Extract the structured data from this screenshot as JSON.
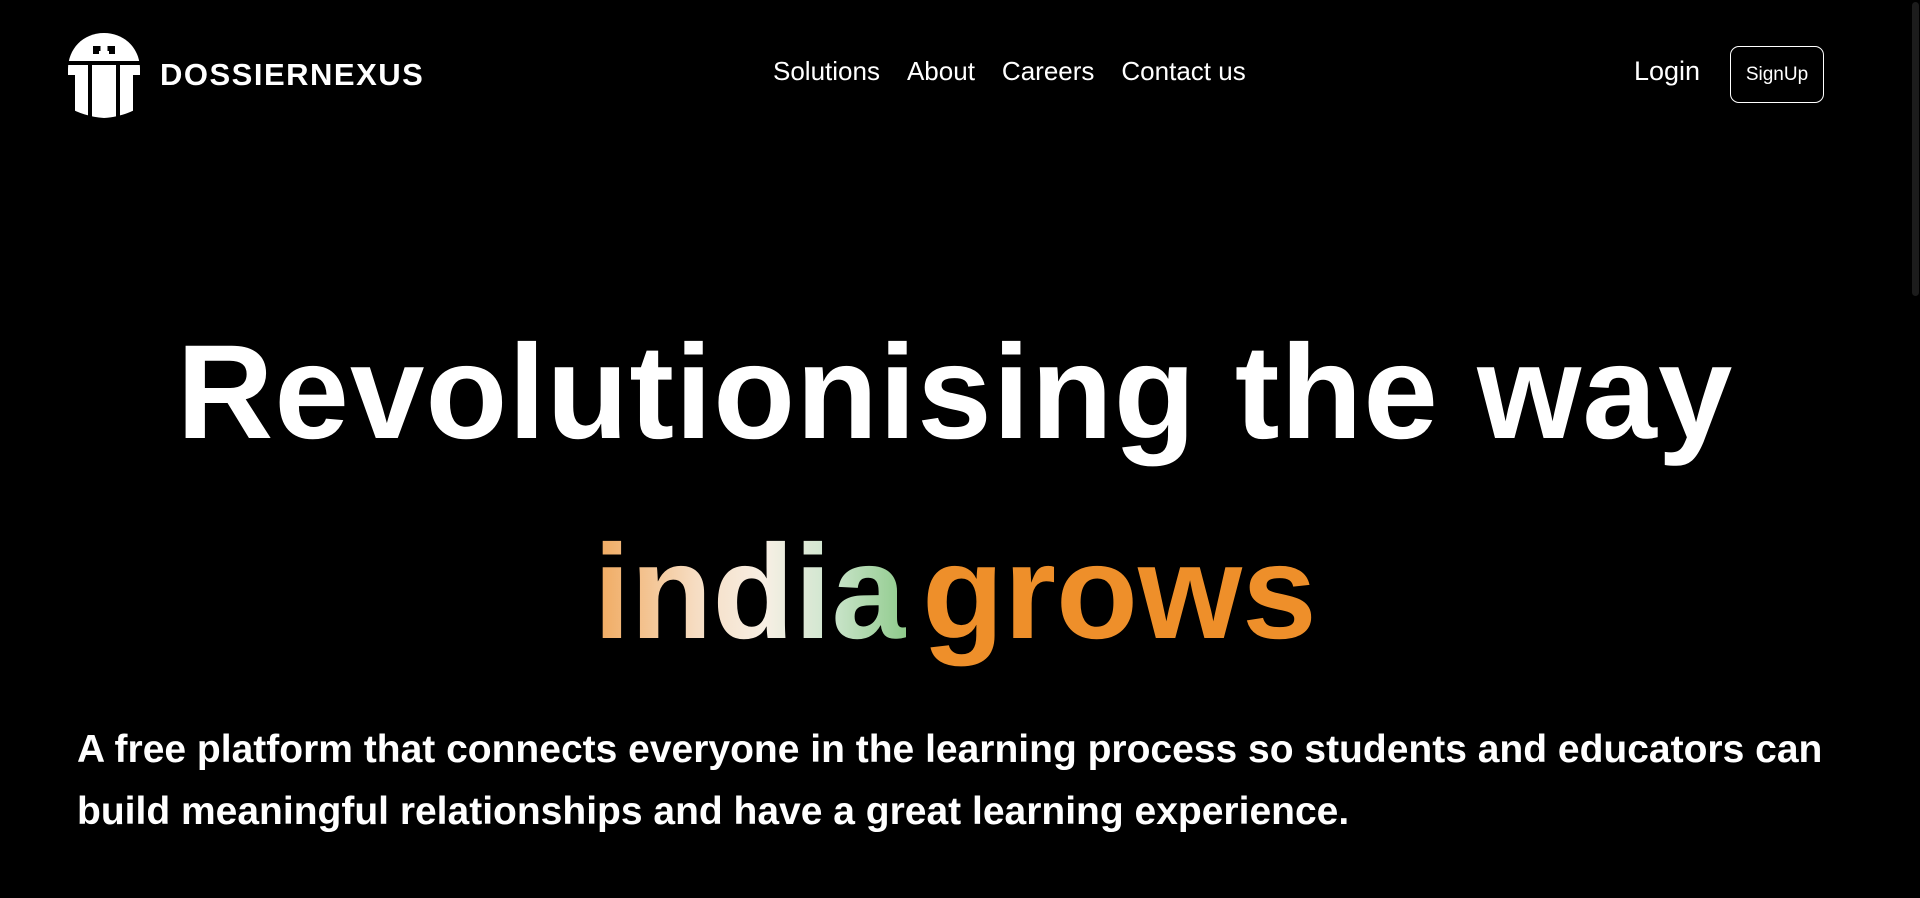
{
  "brand": {
    "name": "DOSSIERNEXUS",
    "logo_icon": "castle-shield-icon"
  },
  "nav": {
    "items": [
      {
        "label": "Solutions"
      },
      {
        "label": "About"
      },
      {
        "label": "Careers"
      },
      {
        "label": "Contact us"
      }
    ]
  },
  "auth": {
    "login_label": "Login",
    "signup_label": "SignUp"
  },
  "hero": {
    "title": "Revolutionising the way",
    "accent_word_1": "india",
    "accent_word_2": "grows",
    "subtitle": "A free platform that connects everyone in the learning process so students and educators can build meaningful relationships and have a great learning experience."
  },
  "colors": {
    "background": "#000000",
    "text": "#ffffff",
    "accent_orange": "#ee8f2a",
    "accent_green": "#8fcb8c"
  }
}
